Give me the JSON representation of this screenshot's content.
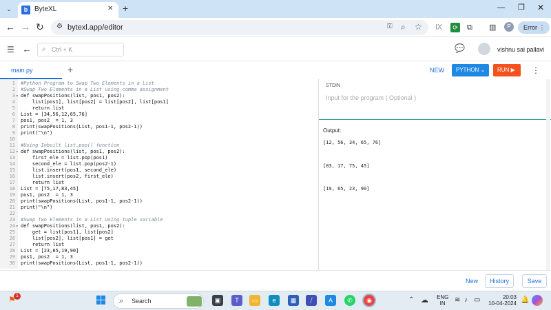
{
  "browser": {
    "tab_title": "ByteXL",
    "tab_favicon_letter": "b",
    "url": "bytexl.app/editor",
    "error_label": "Error",
    "profile_letter": "P"
  },
  "app": {
    "search_placeholder": "Ctrl + K",
    "username": "vishnu sai pallavi"
  },
  "toolbar": {
    "file_name": "main.py",
    "new_label": "NEW",
    "language": "PYTHON",
    "run_label": "RUN"
  },
  "code_lines": [
    {
      "n": "1",
      "fold": "",
      "text": "#Python Program to Swap Two Elements in a List",
      "comment": true
    },
    {
      "n": "2",
      "fold": "",
      "text": "#Swap Two Elements in a List using comma assignment",
      "comment": true
    },
    {
      "n": "3",
      "fold": "▾",
      "text": "def swapPositions(list, pos1, pos2):",
      "comment": false
    },
    {
      "n": "4",
      "fold": "",
      "text": "    list[pos1], list[pos2] = list[pos2], list[pos1]",
      "comment": false
    },
    {
      "n": "5",
      "fold": "",
      "text": "    return list",
      "comment": false
    },
    {
      "n": "6",
      "fold": "",
      "text": "List = [34,56,12,65,76]",
      "comment": false
    },
    {
      "n": "7",
      "fold": "",
      "text": "pos1, pos2  = 1, 3",
      "comment": false
    },
    {
      "n": "8",
      "fold": "",
      "text": "print(swapPositions(List, pos1-1, pos2-1))",
      "comment": false
    },
    {
      "n": "9",
      "fold": "",
      "text": "print(\"\\n\")",
      "comment": false
    },
    {
      "n": "10",
      "fold": "",
      "text": "",
      "comment": false
    },
    {
      "n": "11",
      "fold": "",
      "text": "#Using Inbuilt list.pop() function",
      "comment": true
    },
    {
      "n": "12",
      "fold": "▾",
      "text": "def swapPositions(list, pos1, pos2):",
      "comment": false
    },
    {
      "n": "13",
      "fold": "",
      "text": "    first_ele = list.pop(pos1)",
      "comment": false
    },
    {
      "n": "14",
      "fold": "",
      "text": "    second_ele = list.pop(pos2-1)",
      "comment": false
    },
    {
      "n": "15",
      "fold": "",
      "text": "    list.insert(pos1, second_ele)",
      "comment": false
    },
    {
      "n": "16",
      "fold": "",
      "text": "    list.insert(pos2, first_ele)",
      "comment": false
    },
    {
      "n": "17",
      "fold": "",
      "text": "    return list",
      "comment": false
    },
    {
      "n": "18",
      "fold": "",
      "text": "List = [75,17,83,45]",
      "comment": false
    },
    {
      "n": "19",
      "fold": "",
      "text": "pos1, pos2  = 1, 3",
      "comment": false
    },
    {
      "n": "20",
      "fold": "",
      "text": "print(swapPositions(List, pos1-1, pos2-1))",
      "comment": false
    },
    {
      "n": "21",
      "fold": "",
      "text": "print(\"\\n\")",
      "comment": false
    },
    {
      "n": "22",
      "fold": "",
      "text": "",
      "comment": false
    },
    {
      "n": "23",
      "fold": "",
      "text": "#Swap Two Elements in a List Using tuple variable",
      "comment": true
    },
    {
      "n": "24",
      "fold": "▾",
      "text": "def swapPositions(list, pos1, pos2):",
      "comment": false
    },
    {
      "n": "25",
      "fold": "",
      "text": "    get = list[pos1], list[pos2]",
      "comment": false
    },
    {
      "n": "26",
      "fold": "",
      "text": "    list[pos2], list[pos1] = get",
      "comment": false
    },
    {
      "n": "27",
      "fold": "",
      "text": "    return list",
      "comment": false
    },
    {
      "n": "28",
      "fold": "",
      "text": "List = [23,65,19,90]",
      "comment": false
    },
    {
      "n": "29",
      "fold": "",
      "text": "pos1, pos2  = 1, 3",
      "comment": false
    },
    {
      "n": "30",
      "fold": "",
      "text": "print(swapPositions(List, pos1-1, pos2-1))",
      "comment": false
    }
  ],
  "io": {
    "stdin_label": "STDIN",
    "stdin_placeholder": "Input for the program ( Optional )",
    "output_label": "Output:",
    "output_lines": [
      "[12, 56, 34, 65, 76]",
      "[83, 17, 75, 45]",
      "[19, 65, 23, 90]"
    ]
  },
  "footer": {
    "new_label": "New",
    "history_label": "History",
    "save_label": "Save"
  },
  "taskbar": {
    "notification_count": "1",
    "search_label": "Search",
    "lang_top": "ENG",
    "lang_bottom": "IN",
    "time": "20:03",
    "date": "10-04-2024"
  },
  "colors": {
    "accent": "#1e88e5",
    "run": "#f4511e",
    "divider": "#2ea38a"
  }
}
